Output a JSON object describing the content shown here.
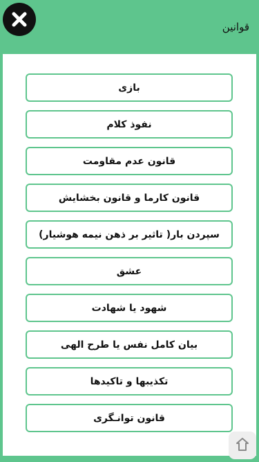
{
  "header": {
    "title": "قوانین",
    "close_icon": "close-x-icon"
  },
  "rules": [
    {
      "label": "بازی"
    },
    {
      "label": "نفوذ کلام"
    },
    {
      "label": "قانون عدم مقاومت"
    },
    {
      "label": "قانون کارما و قانون بخشایش"
    },
    {
      "label": "سپردن بار( تاثیر بر ذهن نیمه هوشیار)"
    },
    {
      "label": "عشق"
    },
    {
      "label": "شهود یا شهادت"
    },
    {
      "label": "بیان کامل نفس یا طرح الهی"
    },
    {
      "label": "تکذیبها و تاکیدها"
    },
    {
      "label": "قانون توانـگری"
    }
  ],
  "colors": {
    "accent": "#5ec58d",
    "close_button": "#111111"
  },
  "watermark_icon": "app-store-watermark-icon"
}
